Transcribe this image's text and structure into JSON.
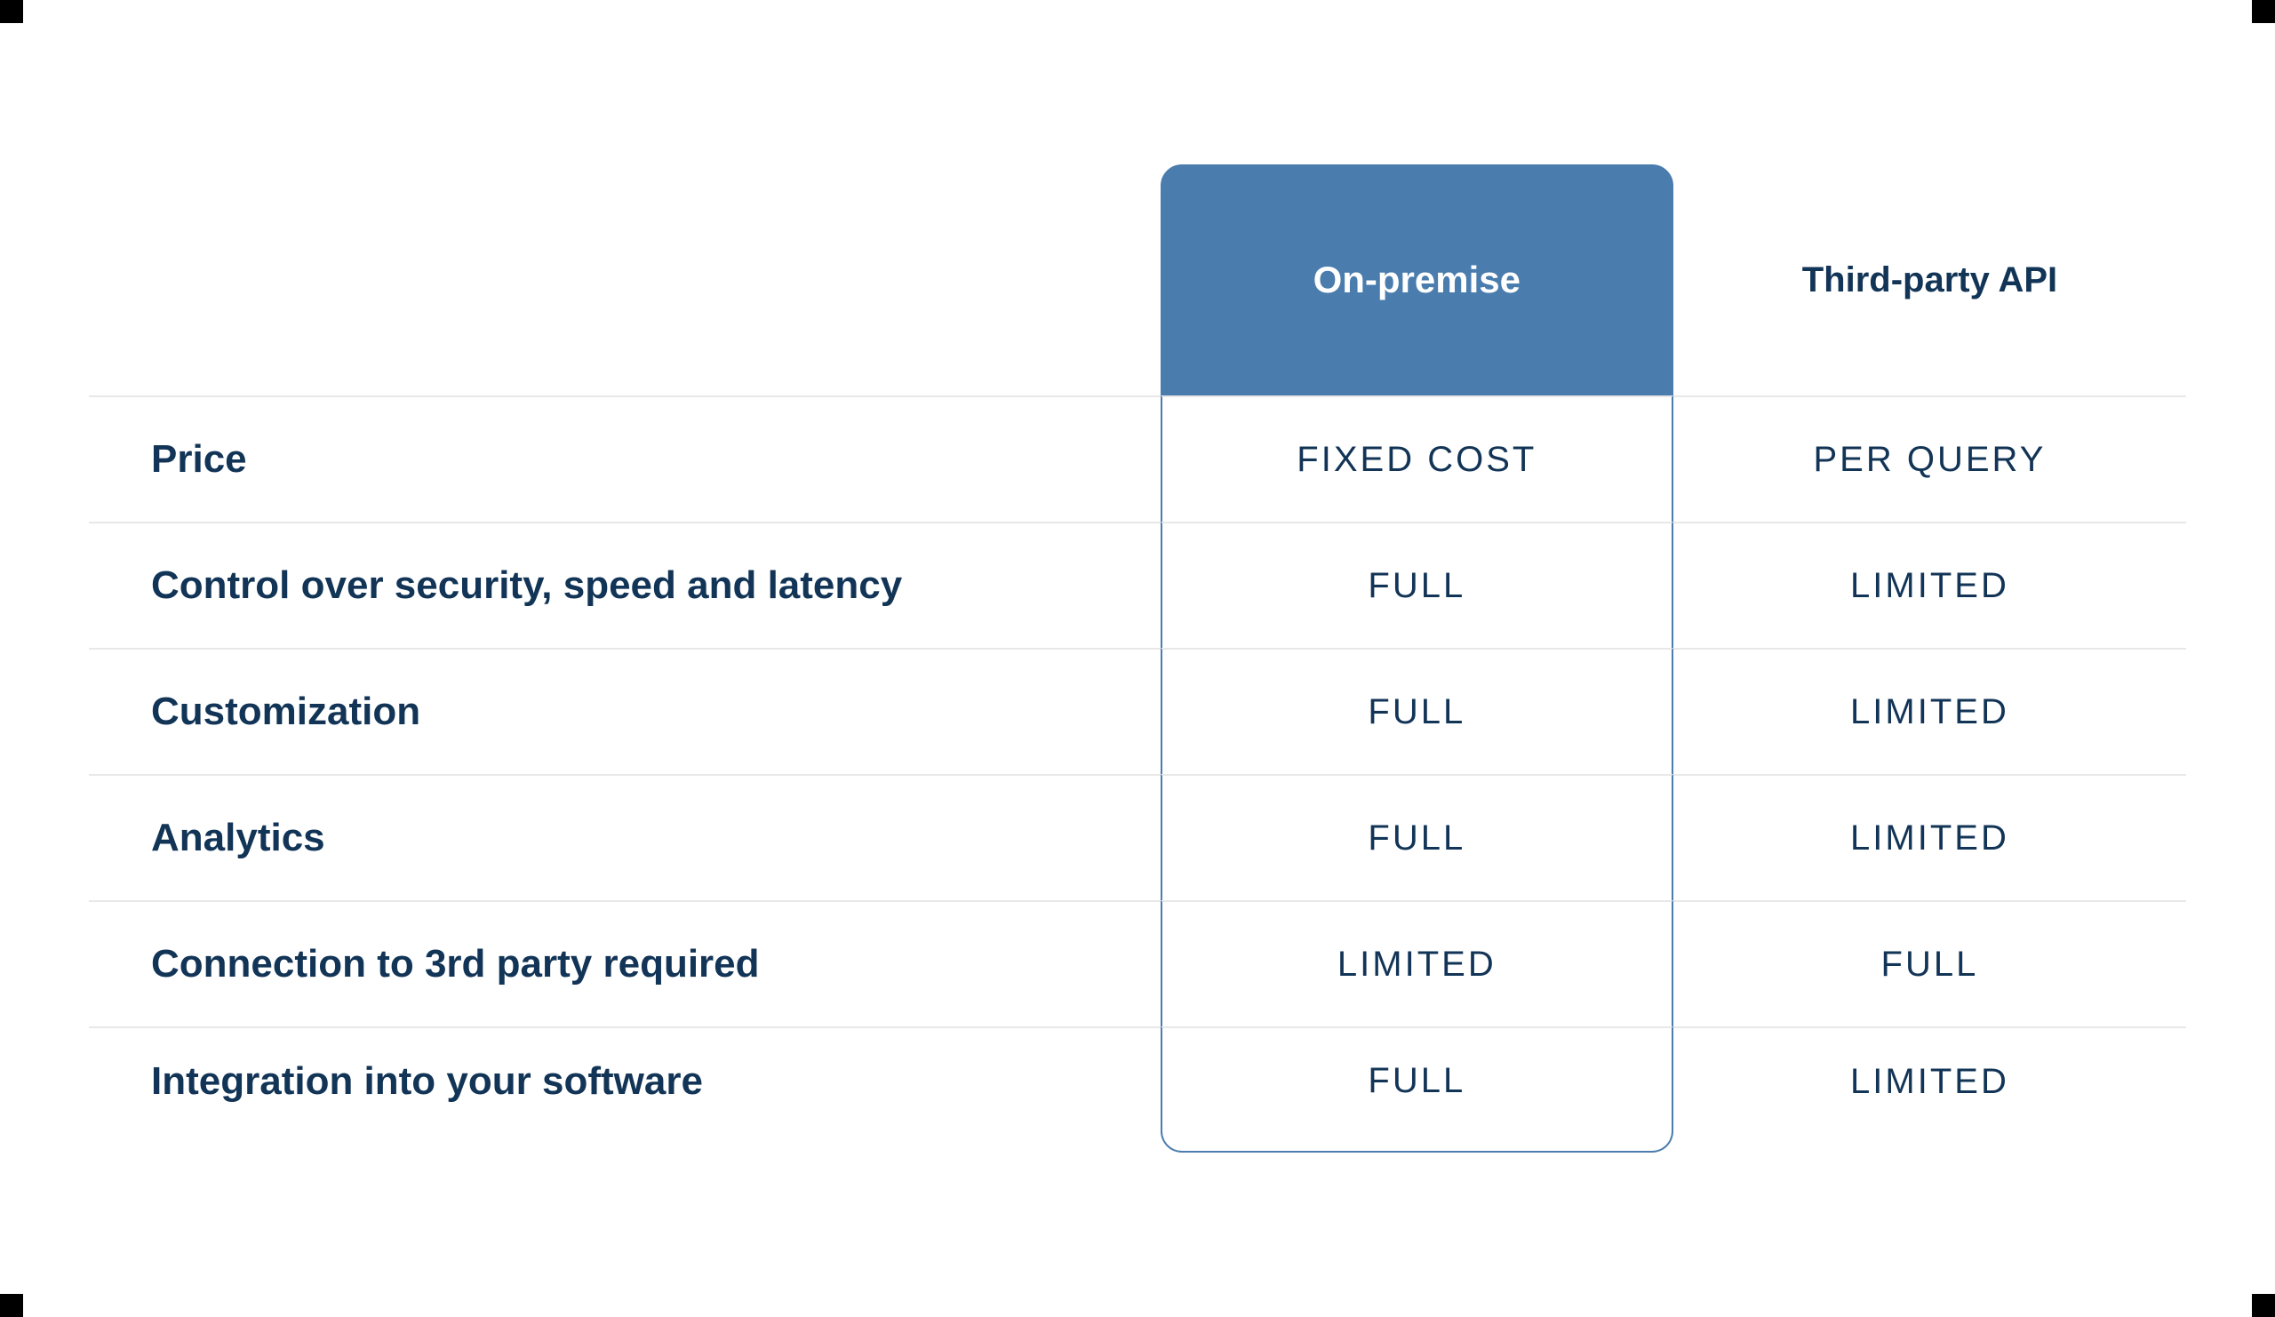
{
  "chart_data": {
    "type": "table",
    "columns": [
      "On-premise",
      "Third-party API"
    ],
    "rows": [
      {
        "label": "Price",
        "values": [
          "FIXED COST",
          "PER QUERY"
        ]
      },
      {
        "label": "Control over security, speed and latency",
        "values": [
          "FULL",
          "LIMITED"
        ]
      },
      {
        "label": "Customization",
        "values": [
          "FULL",
          "LIMITED"
        ]
      },
      {
        "label": "Analytics",
        "values": [
          "FULL",
          "LIMITED"
        ]
      },
      {
        "label": "Connection to 3rd party required",
        "values": [
          "LIMITED",
          "FULL"
        ]
      },
      {
        "label": "Integration into your software",
        "values": [
          "FULL",
          "LIMITED"
        ]
      }
    ]
  },
  "headers": {
    "col1": "On-premise",
    "col2": "Third-party API"
  },
  "rows": {
    "0": {
      "label": "Price",
      "v1": "FIXED COST",
      "v2": "PER QUERY"
    },
    "1": {
      "label": "Control over security, speed and latency",
      "v1": "FULL",
      "v2": "LIMITED"
    },
    "2": {
      "label": "Customization",
      "v1": "FULL",
      "v2": "LIMITED"
    },
    "3": {
      "label": "Analytics",
      "v1": "FULL",
      "v2": "LIMITED"
    },
    "4": {
      "label": "Connection to 3rd party required",
      "v1": "LIMITED",
      "v2": "FULL"
    },
    "5": {
      "label": "Integration into your software",
      "v1": "FULL",
      "v2": "LIMITED"
    }
  }
}
